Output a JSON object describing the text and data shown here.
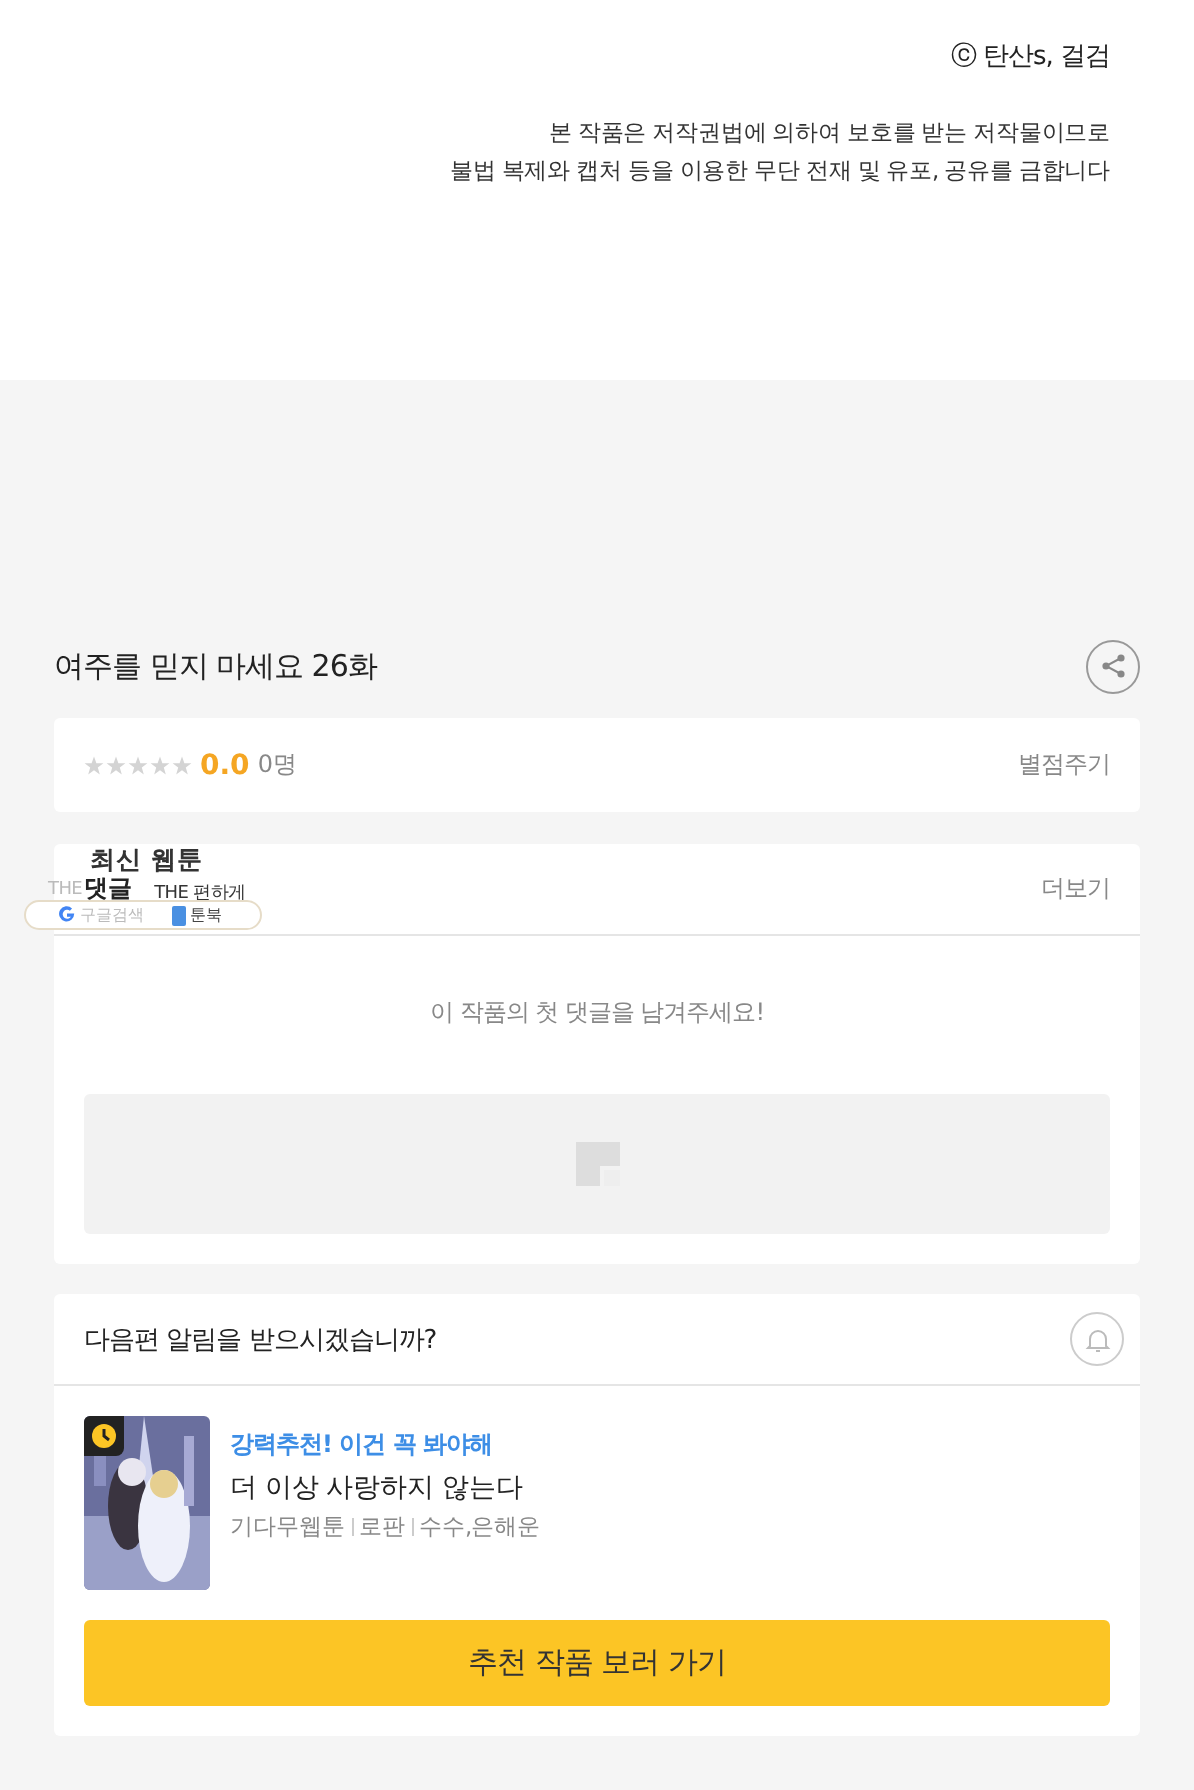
{
  "copyright": "ⓒ 탄산s, 걸검",
  "notice": [
    "본 작품은 저작권법에 의하여 보호를 받는 저작물이므로",
    "불법 복제와 캡처 등을 이용한 무단 전재 및 유포, 공유를 금합니다"
  ],
  "episode": {
    "title": "여주를 믿지 마세요 26화"
  },
  "rating": {
    "stars": 0,
    "score": "0.0",
    "count": "0명",
    "action": "별점주기"
  },
  "comments": {
    "title": "댓글",
    "more": "더보기",
    "empty": "이 작품의 첫 댓글을 남겨주세요!"
  },
  "overlay": {
    "title": "최신 웹툰",
    "line_left": "THE",
    "line_right": "THE 편하게",
    "links": [
      "구글검색",
      "툰북"
    ]
  },
  "alert": {
    "question": "다음편 알림을 받으시겠습니까?"
  },
  "recommendation": {
    "tagline": "강력추천! 이건 꼭 봐야해",
    "title": "더 이상 사랑하지 않는다",
    "meta": [
      "기다무웹툰",
      "로판",
      "수수,은해운"
    ],
    "button": "추천 작품 보러 가기"
  }
}
